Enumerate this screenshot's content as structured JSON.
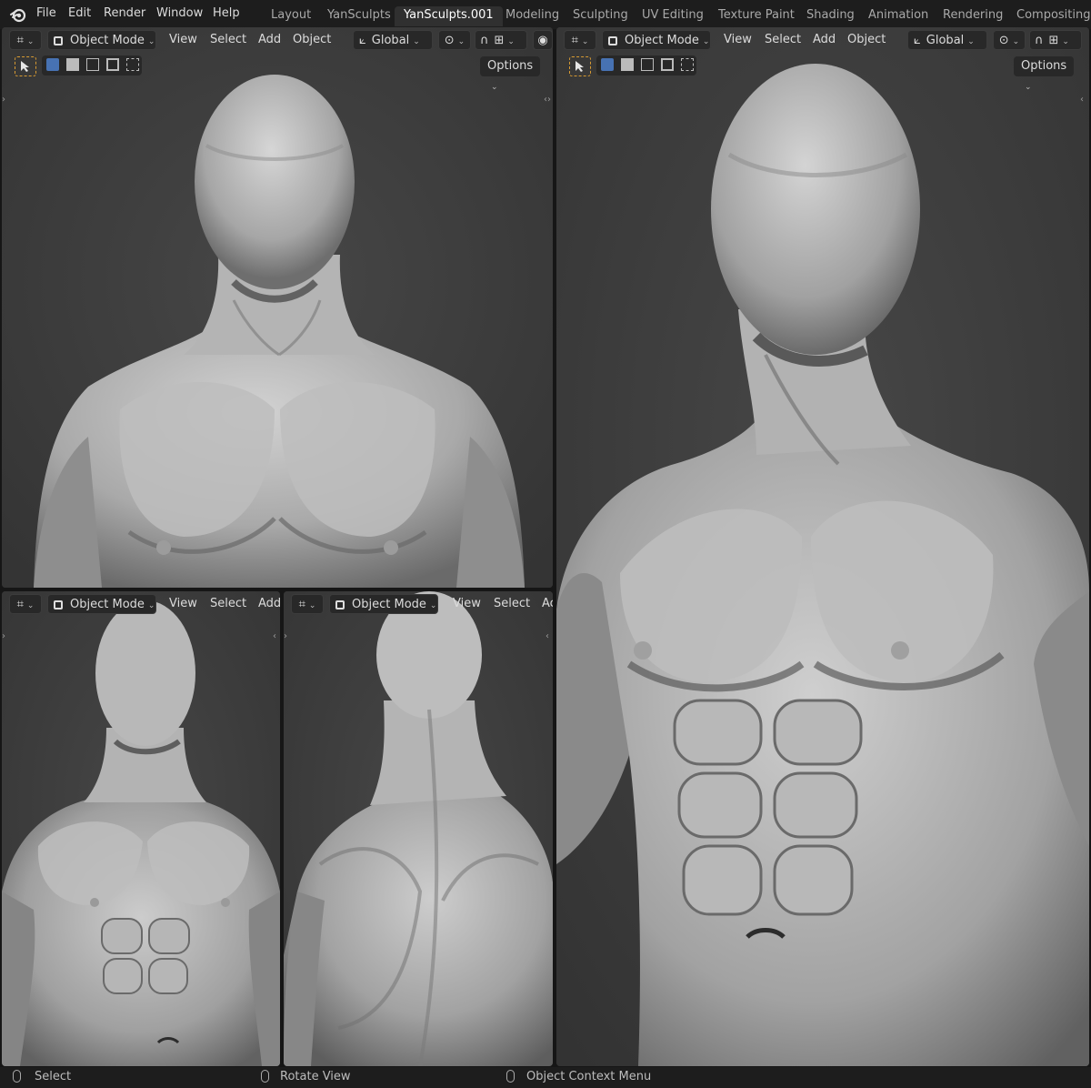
{
  "topbar": {
    "menu": [
      "File",
      "Edit",
      "Render",
      "Window",
      "Help"
    ],
    "workspaces": [
      "Layout",
      "YanSculpts",
      "YanSculpts.001",
      "Modeling",
      "Sculpting",
      "UV Editing",
      "Texture Paint",
      "Shading",
      "Animation",
      "Rendering",
      "Compositing"
    ],
    "active_workspace": "YanSculpts.001"
  },
  "viewports": [
    {
      "name": "top-left",
      "mode": "Object Mode",
      "menus": [
        "View",
        "Select",
        "Add",
        "Object"
      ],
      "transform_orientation": "Global",
      "options_label": "Options",
      "view": "front view, chest and head"
    },
    {
      "name": "right",
      "mode": "Object Mode",
      "menus": [
        "View",
        "Select",
        "Add",
        "Object"
      ],
      "transform_orientation": "Global",
      "options_label": "Options",
      "view": "front close-up, torso"
    },
    {
      "name": "bottom-left",
      "mode": "Object Mode",
      "menus": [
        "View",
        "Select",
        "Add"
      ],
      "view": "front view, full torso"
    },
    {
      "name": "bottom-middle",
      "mode": "Object Mode",
      "menus": [
        "View",
        "Select",
        "Ac"
      ],
      "view": "back three-quarter view"
    }
  ],
  "statusbar": {
    "left": "Select",
    "middle": "Rotate View",
    "right": "Object Context Menu"
  },
  "colors": {
    "viewport_bg": "#3a3a3a",
    "header_bg": "#282828",
    "active_blue": "#4772b3",
    "select_outline": "#d79a32",
    "sculpt_light": "#c8c8c8",
    "sculpt_shadow": "#5c5c5c"
  }
}
